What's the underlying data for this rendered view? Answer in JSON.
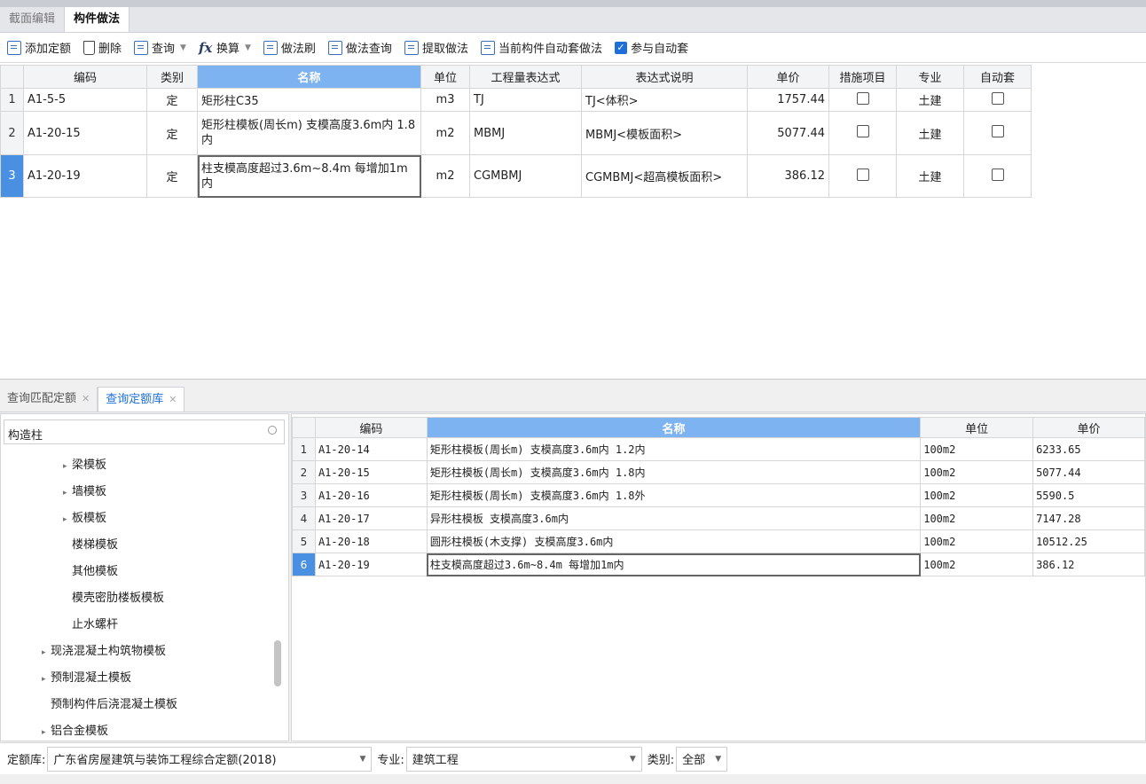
{
  "top_tabs": [
    "截面编辑",
    "构件做法"
  ],
  "toolbar": {
    "add_quota": "添加定额",
    "delete": "删除",
    "query": "查询",
    "convert": "换算",
    "method_brush": "做法刷",
    "method_query": "做法查询",
    "extract_method": "提取做法",
    "auto_apply_current": "当前构件自动套做法",
    "join_auto_apply": "参与自动套",
    "join_auto_apply_checked": true
  },
  "upper_grid": {
    "columns": [
      "编码",
      "类别",
      "名称",
      "单位",
      "工程量表达式",
      "表达式说明",
      "单价",
      "措施项目",
      "专业",
      "自动套"
    ],
    "rows": [
      {
        "num": "1",
        "code": "A1-5-5",
        "type": "定",
        "name": "矩形柱C35",
        "unit": "m3",
        "expr": "TJ",
        "desc": "TJ<体积>",
        "price": "1757.44",
        "measure": false,
        "major": "土建",
        "auto": false
      },
      {
        "num": "2",
        "code": "A1-20-15",
        "type": "定",
        "name": "矩形柱模板(周长m) 支模高度3.6m内 1.8内",
        "unit": "m2",
        "expr": "MBMJ",
        "desc": "MBMJ<模板面积>",
        "price": "5077.44",
        "measure": false,
        "major": "土建",
        "auto": false
      },
      {
        "num": "3",
        "code": "A1-20-19",
        "type": "定",
        "name": "柱支模高度超过3.6m~8.4m 每增加1m内",
        "unit": "m2",
        "expr": "CGMBMJ",
        "desc": "CGMBMJ<超高模板面积>",
        "price": "386.12",
        "measure": false,
        "major": "土建",
        "auto": false
      }
    ]
  },
  "bottom_tabs": [
    "查询匹配定额",
    "查询定额库"
  ],
  "search": {
    "value": "构造柱"
  },
  "tree": [
    {
      "label": "梁模板",
      "indent": 2,
      "arrow": true
    },
    {
      "label": "墙模板",
      "indent": 2,
      "arrow": true
    },
    {
      "label": "板模板",
      "indent": 2,
      "arrow": true
    },
    {
      "label": "楼梯模板",
      "indent": 2,
      "arrow": false
    },
    {
      "label": "其他模板",
      "indent": 2,
      "arrow": false
    },
    {
      "label": "模壳密肋楼板模板",
      "indent": 2,
      "arrow": false
    },
    {
      "label": "止水螺杆",
      "indent": 2,
      "arrow": false
    },
    {
      "label": "现浇混凝土构筑物模板",
      "indent": 1,
      "arrow": true
    },
    {
      "label": "预制混凝土模板",
      "indent": 1,
      "arrow": true
    },
    {
      "label": "预制构件后浇混凝土模板",
      "indent": 1,
      "arrow": false
    },
    {
      "label": "铝合金模板",
      "indent": 1,
      "arrow": true
    }
  ],
  "lower_grid": {
    "columns": [
      "编码",
      "名称",
      "单位",
      "单价"
    ],
    "rows": [
      {
        "num": "1",
        "code": "A1-20-14",
        "name": "矩形柱模板(周长m) 支模高度3.6m内 1.2内",
        "unit": "100m2",
        "price": "6233.65"
      },
      {
        "num": "2",
        "code": "A1-20-15",
        "name": "矩形柱模板(周长m) 支模高度3.6m内 1.8内",
        "unit": "100m2",
        "price": "5077.44"
      },
      {
        "num": "3",
        "code": "A1-20-16",
        "name": "矩形柱模板(周长m) 支模高度3.6m内 1.8外",
        "unit": "100m2",
        "price": "5590.5"
      },
      {
        "num": "4",
        "code": "A1-20-17",
        "name": "异形柱模板 支模高度3.6m内",
        "unit": "100m2",
        "price": "7147.28"
      },
      {
        "num": "5",
        "code": "A1-20-18",
        "name": "圆形柱模板(木支撑) 支模高度3.6m内",
        "unit": "100m2",
        "price": "10512.25"
      },
      {
        "num": "6",
        "code": "A1-20-19",
        "name": "柱支模高度超过3.6m~8.4m 每增加1m内",
        "unit": "100m2",
        "price": "386.12"
      }
    ]
  },
  "footer": {
    "lib_label": "定额库:",
    "lib_value": "广东省房屋建筑与装饰工程综合定额(2018)",
    "major_label": "专业:",
    "major_value": "建筑工程",
    "type_label": "类别:",
    "type_value": "全部"
  },
  "colors": {
    "accent": "#1e6fd9",
    "header_selected": "#7db3f0",
    "row_selected": "#4a90e2"
  }
}
